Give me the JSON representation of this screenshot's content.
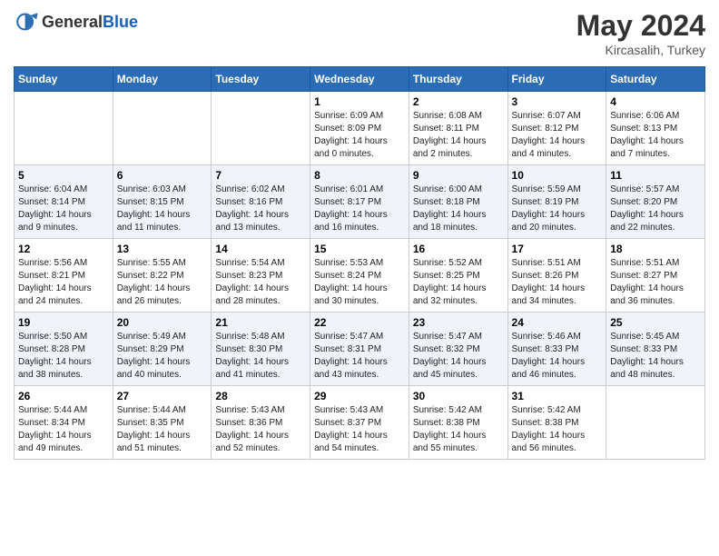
{
  "header": {
    "logo_general": "General",
    "logo_blue": "Blue",
    "month_year": "May 2024",
    "location": "Kircasalih, Turkey"
  },
  "days_of_week": [
    "Sunday",
    "Monday",
    "Tuesday",
    "Wednesday",
    "Thursday",
    "Friday",
    "Saturday"
  ],
  "weeks": [
    [
      {
        "day": "",
        "info": ""
      },
      {
        "day": "",
        "info": ""
      },
      {
        "day": "",
        "info": ""
      },
      {
        "day": "1",
        "sunrise": "Sunrise: 6:09 AM",
        "sunset": "Sunset: 8:09 PM",
        "daylight": "Daylight: 14 hours and 0 minutes."
      },
      {
        "day": "2",
        "sunrise": "Sunrise: 6:08 AM",
        "sunset": "Sunset: 8:11 PM",
        "daylight": "Daylight: 14 hours and 2 minutes."
      },
      {
        "day": "3",
        "sunrise": "Sunrise: 6:07 AM",
        "sunset": "Sunset: 8:12 PM",
        "daylight": "Daylight: 14 hours and 4 minutes."
      },
      {
        "day": "4",
        "sunrise": "Sunrise: 6:06 AM",
        "sunset": "Sunset: 8:13 PM",
        "daylight": "Daylight: 14 hours and 7 minutes."
      }
    ],
    [
      {
        "day": "5",
        "sunrise": "Sunrise: 6:04 AM",
        "sunset": "Sunset: 8:14 PM",
        "daylight": "Daylight: 14 hours and 9 minutes."
      },
      {
        "day": "6",
        "sunrise": "Sunrise: 6:03 AM",
        "sunset": "Sunset: 8:15 PM",
        "daylight": "Daylight: 14 hours and 11 minutes."
      },
      {
        "day": "7",
        "sunrise": "Sunrise: 6:02 AM",
        "sunset": "Sunset: 8:16 PM",
        "daylight": "Daylight: 14 hours and 13 minutes."
      },
      {
        "day": "8",
        "sunrise": "Sunrise: 6:01 AM",
        "sunset": "Sunset: 8:17 PM",
        "daylight": "Daylight: 14 hours and 16 minutes."
      },
      {
        "day": "9",
        "sunrise": "Sunrise: 6:00 AM",
        "sunset": "Sunset: 8:18 PM",
        "daylight": "Daylight: 14 hours and 18 minutes."
      },
      {
        "day": "10",
        "sunrise": "Sunrise: 5:59 AM",
        "sunset": "Sunset: 8:19 PM",
        "daylight": "Daylight: 14 hours and 20 minutes."
      },
      {
        "day": "11",
        "sunrise": "Sunrise: 5:57 AM",
        "sunset": "Sunset: 8:20 PM",
        "daylight": "Daylight: 14 hours and 22 minutes."
      }
    ],
    [
      {
        "day": "12",
        "sunrise": "Sunrise: 5:56 AM",
        "sunset": "Sunset: 8:21 PM",
        "daylight": "Daylight: 14 hours and 24 minutes."
      },
      {
        "day": "13",
        "sunrise": "Sunrise: 5:55 AM",
        "sunset": "Sunset: 8:22 PM",
        "daylight": "Daylight: 14 hours and 26 minutes."
      },
      {
        "day": "14",
        "sunrise": "Sunrise: 5:54 AM",
        "sunset": "Sunset: 8:23 PM",
        "daylight": "Daylight: 14 hours and 28 minutes."
      },
      {
        "day": "15",
        "sunrise": "Sunrise: 5:53 AM",
        "sunset": "Sunset: 8:24 PM",
        "daylight": "Daylight: 14 hours and 30 minutes."
      },
      {
        "day": "16",
        "sunrise": "Sunrise: 5:52 AM",
        "sunset": "Sunset: 8:25 PM",
        "daylight": "Daylight: 14 hours and 32 minutes."
      },
      {
        "day": "17",
        "sunrise": "Sunrise: 5:51 AM",
        "sunset": "Sunset: 8:26 PM",
        "daylight": "Daylight: 14 hours and 34 minutes."
      },
      {
        "day": "18",
        "sunrise": "Sunrise: 5:51 AM",
        "sunset": "Sunset: 8:27 PM",
        "daylight": "Daylight: 14 hours and 36 minutes."
      }
    ],
    [
      {
        "day": "19",
        "sunrise": "Sunrise: 5:50 AM",
        "sunset": "Sunset: 8:28 PM",
        "daylight": "Daylight: 14 hours and 38 minutes."
      },
      {
        "day": "20",
        "sunrise": "Sunrise: 5:49 AM",
        "sunset": "Sunset: 8:29 PM",
        "daylight": "Daylight: 14 hours and 40 minutes."
      },
      {
        "day": "21",
        "sunrise": "Sunrise: 5:48 AM",
        "sunset": "Sunset: 8:30 PM",
        "daylight": "Daylight: 14 hours and 41 minutes."
      },
      {
        "day": "22",
        "sunrise": "Sunrise: 5:47 AM",
        "sunset": "Sunset: 8:31 PM",
        "daylight": "Daylight: 14 hours and 43 minutes."
      },
      {
        "day": "23",
        "sunrise": "Sunrise: 5:47 AM",
        "sunset": "Sunset: 8:32 PM",
        "daylight": "Daylight: 14 hours and 45 minutes."
      },
      {
        "day": "24",
        "sunrise": "Sunrise: 5:46 AM",
        "sunset": "Sunset: 8:33 PM",
        "daylight": "Daylight: 14 hours and 46 minutes."
      },
      {
        "day": "25",
        "sunrise": "Sunrise: 5:45 AM",
        "sunset": "Sunset: 8:33 PM",
        "daylight": "Daylight: 14 hours and 48 minutes."
      }
    ],
    [
      {
        "day": "26",
        "sunrise": "Sunrise: 5:44 AM",
        "sunset": "Sunset: 8:34 PM",
        "daylight": "Daylight: 14 hours and 49 minutes."
      },
      {
        "day": "27",
        "sunrise": "Sunrise: 5:44 AM",
        "sunset": "Sunset: 8:35 PM",
        "daylight": "Daylight: 14 hours and 51 minutes."
      },
      {
        "day": "28",
        "sunrise": "Sunrise: 5:43 AM",
        "sunset": "Sunset: 8:36 PM",
        "daylight": "Daylight: 14 hours and 52 minutes."
      },
      {
        "day": "29",
        "sunrise": "Sunrise: 5:43 AM",
        "sunset": "Sunset: 8:37 PM",
        "daylight": "Daylight: 14 hours and 54 minutes."
      },
      {
        "day": "30",
        "sunrise": "Sunrise: 5:42 AM",
        "sunset": "Sunset: 8:38 PM",
        "daylight": "Daylight: 14 hours and 55 minutes."
      },
      {
        "day": "31",
        "sunrise": "Sunrise: 5:42 AM",
        "sunset": "Sunset: 8:38 PM",
        "daylight": "Daylight: 14 hours and 56 minutes."
      },
      {
        "day": "",
        "info": ""
      }
    ]
  ]
}
